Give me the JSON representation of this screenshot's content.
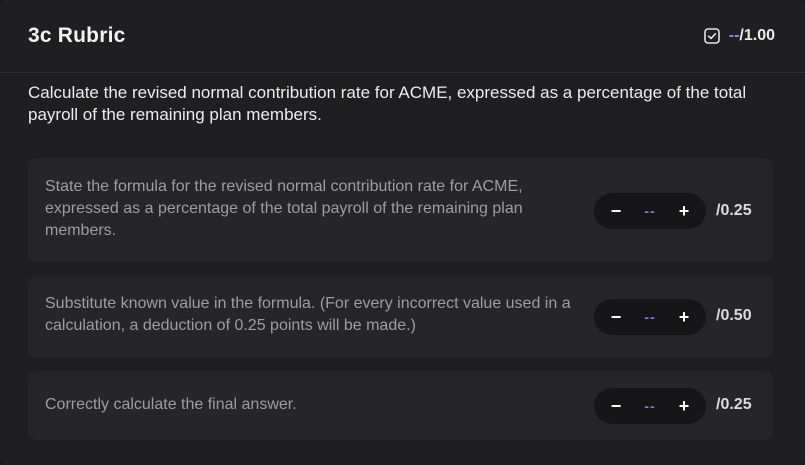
{
  "header": {
    "title": "3c Rubric",
    "score_value": "--",
    "score_max": "/1.00",
    "icon": "check-square-icon"
  },
  "question": "Calculate the revised normal contribution rate for ACME, expressed as a percentage of the total payroll of the remaining plan members.",
  "criteria": [
    {
      "text": "State the formula for the revised normal contribution rate for ACME, expressed as a percentage of the total payroll of the remaining plan members.",
      "decrement": "−",
      "value": "--",
      "increment": "+",
      "max": "/0.25"
    },
    {
      "text": "Substitute known value in the formula. (For every incorrect value used in a calculation, a deduction of 0.25 points will be made.)",
      "decrement": "−",
      "value": "--",
      "increment": "+",
      "max": "/0.50"
    },
    {
      "text": "Correctly calculate the final answer.",
      "decrement": "−",
      "value": "--",
      "increment": "+",
      "max": "/0.25"
    }
  ],
  "colors": {
    "background": "#1f1f21",
    "card": "#262628",
    "stepper": "#161618",
    "accent": "#8b8cf0"
  }
}
